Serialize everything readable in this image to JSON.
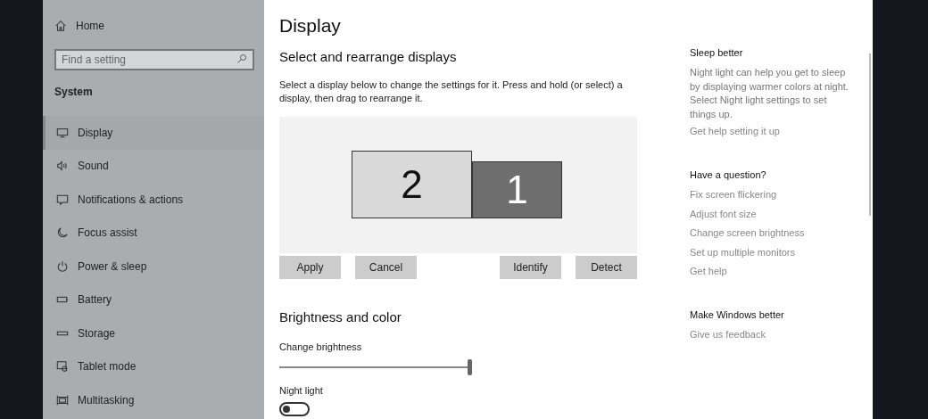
{
  "sidebar": {
    "home": "Home",
    "search": {
      "placeholder": "Find a setting"
    },
    "section": "System",
    "items": [
      {
        "label": "Display",
        "selected": true
      },
      {
        "label": "Sound",
        "selected": false
      },
      {
        "label": "Notifications & actions",
        "selected": false
      },
      {
        "label": "Focus assist",
        "selected": false
      },
      {
        "label": "Power & sleep",
        "selected": false
      },
      {
        "label": "Battery",
        "selected": false
      },
      {
        "label": "Storage",
        "selected": false
      },
      {
        "label": "Tablet mode",
        "selected": false
      },
      {
        "label": "Multitasking",
        "selected": false
      }
    ]
  },
  "main": {
    "title": "Display",
    "arrange": {
      "heading": "Select and rearrange displays",
      "description": "Select a display below to change the settings for it. Press and hold (or select) a display, then drag to rearrange it.",
      "displays": [
        {
          "label": "2",
          "selected": false
        },
        {
          "label": "1",
          "selected": true
        }
      ],
      "buttons": [
        "Apply",
        "Cancel",
        "Identify",
        "Detect"
      ]
    },
    "brightness": {
      "heading": "Brightness and color",
      "slider": {
        "label": "Change brightness",
        "level": 1
      },
      "night_light": {
        "label": "Night light",
        "on": false
      }
    }
  },
  "aside": [
    {
      "heading": "Sleep better",
      "text": "Night light can help you get to sleep by displaying warmer colors at night. Select Night light settings to set things up.",
      "links": [
        "Get help setting it up"
      ]
    },
    {
      "heading": "Have a question?",
      "links": [
        "Fix screen flickering",
        "Adjust font size",
        "Change screen brightness",
        "Set up multiple monitors",
        "Get help"
      ]
    },
    {
      "heading": "Make Windows better",
      "links": [
        "Give us feedback"
      ]
    }
  ]
}
